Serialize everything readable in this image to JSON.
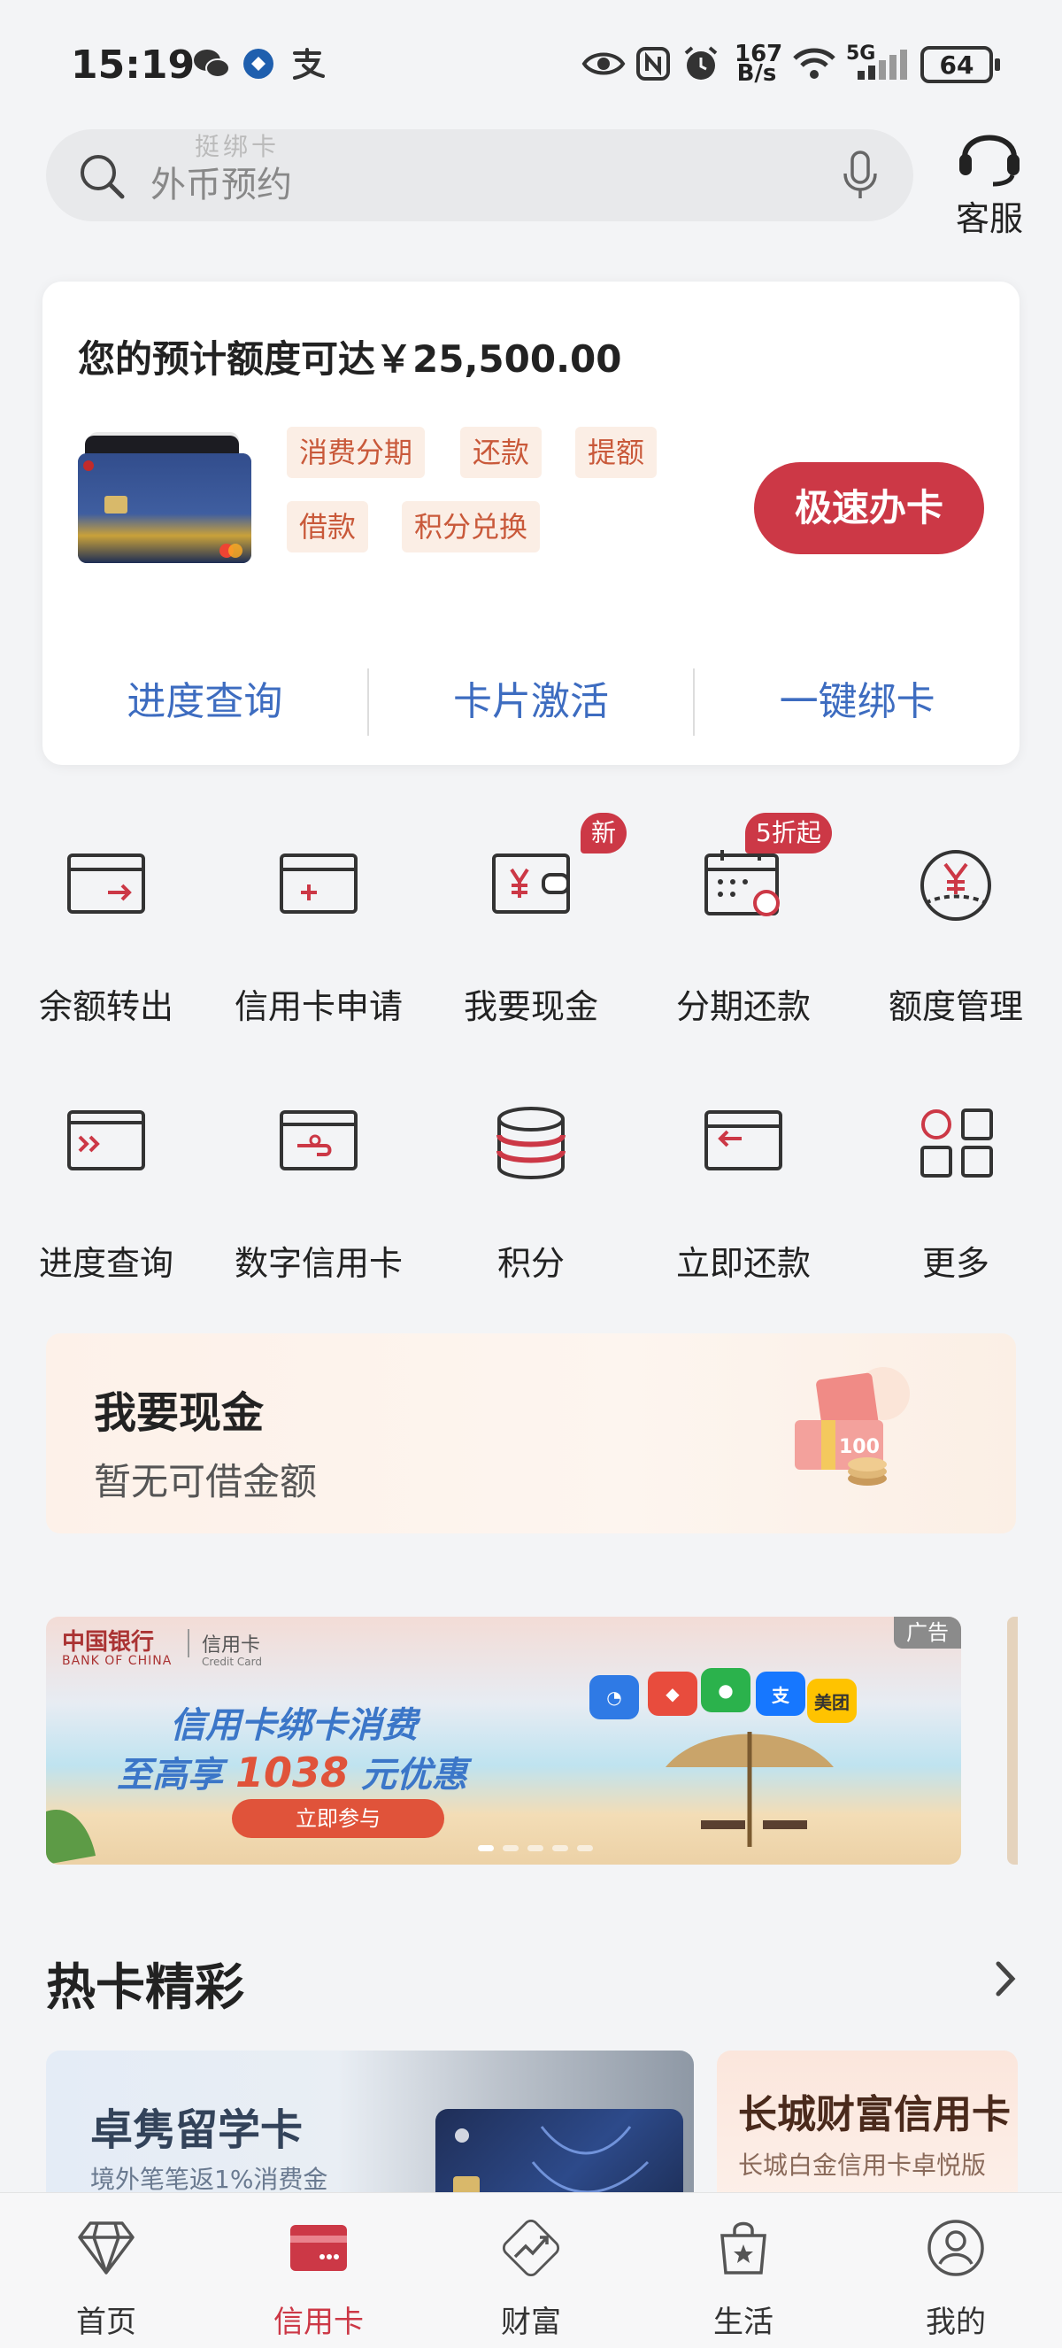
{
  "status_bar": {
    "time": "15:19",
    "net_speed_top": "167",
    "net_speed_bottom": "B/s",
    "network": "5G",
    "battery": "64",
    "icons": [
      "wechat-icon",
      "app-icon",
      "alipay-icon",
      "eye-icon",
      "nfc-icon",
      "alarm-icon",
      "wifi-icon",
      "signal-icon"
    ]
  },
  "search": {
    "placeholder": "外币预约",
    "ghost_text": "挺绑卡",
    "service_label": "客服"
  },
  "card_box": {
    "limit_text": "您的预计额度可达￥25,500.00",
    "tags": [
      "消费分期",
      "还款",
      "提额",
      "借款",
      "积分兑换"
    ],
    "apply_button": "极速办卡",
    "links": [
      "进度查询",
      "卡片激活",
      "一键绑卡"
    ]
  },
  "grid": [
    {
      "label": "余额转出",
      "icon": "card-transfer-out-icon",
      "badge": ""
    },
    {
      "label": "信用卡申请",
      "icon": "card-apply-icon",
      "badge": ""
    },
    {
      "label": "我要现金",
      "icon": "wallet-cash-icon",
      "badge": "新"
    },
    {
      "label": "分期还款",
      "icon": "calendar-installment-icon",
      "badge": "5折起"
    },
    {
      "label": "额度管理",
      "icon": "limit-manage-icon",
      "badge": ""
    },
    {
      "label": "进度查询",
      "icon": "progress-query-icon",
      "badge": ""
    },
    {
      "label": "数字信用卡",
      "icon": "digital-card-icon",
      "badge": ""
    },
    {
      "label": "积分",
      "icon": "points-coins-icon",
      "badge": ""
    },
    {
      "label": "立即还款",
      "icon": "repay-now-icon",
      "badge": ""
    },
    {
      "label": "更多",
      "icon": "more-grid-icon",
      "badge": ""
    }
  ],
  "cash_banner": {
    "title": "我要现金",
    "subtitle": "暂无可借金额",
    "money_label": "100"
  },
  "ad_banner": {
    "tag": "广告",
    "bank_cn": "中国银行",
    "bank_en": "BANK OF CHINA",
    "card_cn": "信用卡",
    "card_en": "Credit Card",
    "line1": "信用卡绑卡消费",
    "line2_prefix": "至高享",
    "line2_amount": "1038",
    "line2_suffix": "元优惠",
    "button": "立即参与",
    "app_meituan": "美团"
  },
  "hot_cards": {
    "title": "热卡精彩",
    "cards": [
      {
        "title": "卓隽留学卡",
        "subtitle": "境外笔笔返1%消费金"
      },
      {
        "title": "长城财富信用卡",
        "subtitle": "长城白金信用卡卓悦版"
      }
    ]
  },
  "bottom_nav": [
    {
      "label": "首页",
      "icon": "diamond-home-icon",
      "active": false
    },
    {
      "label": "信用卡",
      "icon": "credit-card-nav-icon",
      "active": true
    },
    {
      "label": "财富",
      "icon": "wealth-chart-icon",
      "active": false
    },
    {
      "label": "生活",
      "icon": "shopping-bag-icon",
      "active": false
    },
    {
      "label": "我的",
      "icon": "user-profile-icon",
      "active": false
    }
  ],
  "colors": {
    "accent_red": "#cc3846",
    "link_blue": "#3d6cc0",
    "tag_bg": "#fbeee5",
    "tag_text": "#c9593a"
  }
}
